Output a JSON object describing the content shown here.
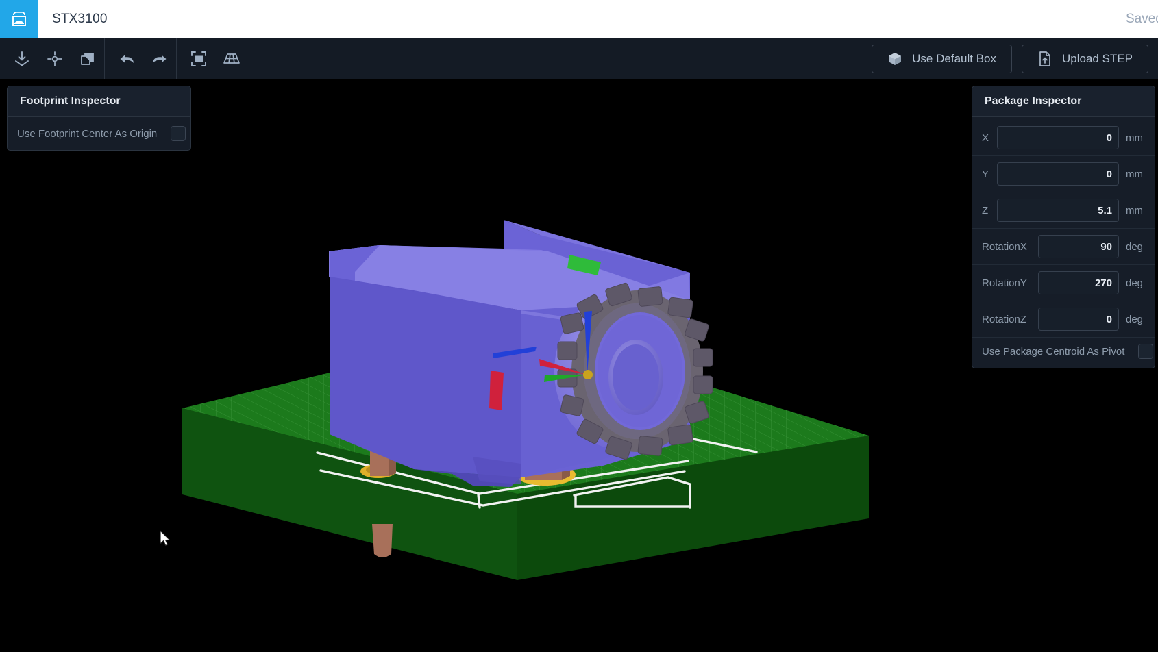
{
  "header": {
    "logo_icon": "pcb-package-logo-icon",
    "title": "STX3100",
    "saved_versions_label": "Saved vers"
  },
  "toolbar": {
    "buttons": [
      {
        "name": "import-icon",
        "tooltip": "Import"
      },
      {
        "name": "set-origin-icon",
        "tooltip": "Set Origin"
      },
      {
        "name": "duplicate-icon",
        "tooltip": "Duplicate"
      },
      {
        "name": "undo-icon",
        "tooltip": "Undo"
      },
      {
        "name": "redo-icon",
        "tooltip": "Redo"
      },
      {
        "name": "fit-view-icon",
        "tooltip": "Fit View"
      },
      {
        "name": "grid-view-icon",
        "tooltip": "Grid View"
      }
    ],
    "default_box_label": "Use Default Box",
    "default_box_icon": "cube-icon",
    "upload_step_label": "Upload STEP",
    "upload_step_icon": "file-upload-icon"
  },
  "footprint_inspector": {
    "title": "Footprint Inspector",
    "use_center_label": "Use Footprint Center As Origin",
    "use_center_checked": false
  },
  "package_inspector": {
    "title": "Package Inspector",
    "fields": [
      {
        "label": "X",
        "value": "0",
        "unit": "mm"
      },
      {
        "label": "Y",
        "value": "0",
        "unit": "mm"
      },
      {
        "label": "Z",
        "value": "5.1",
        "unit": "mm"
      },
      {
        "label": "RotationX",
        "value": "90",
        "unit": "deg"
      },
      {
        "label": "RotationY",
        "value": "270",
        "unit": "deg"
      },
      {
        "label": "RotationZ",
        "value": "0",
        "unit": "deg"
      }
    ],
    "use_centroid_label": "Use Package Centroid As Pivot",
    "use_centroid_checked": false
  },
  "viewport": {
    "background_color": "#000000",
    "board_color": "#1d7a1d",
    "package_color": "#6b63d6",
    "pad_color": "#e8b92c",
    "pin_color": "#a8705a",
    "trace_color": "#f0f0f0",
    "axis_x_color": "#d0213c",
    "axis_y_color": "#1fa82a",
    "axis_z_color": "#2240d8",
    "marker_green_color": "#2fbb3a",
    "wheel_color": "#6a6470"
  }
}
